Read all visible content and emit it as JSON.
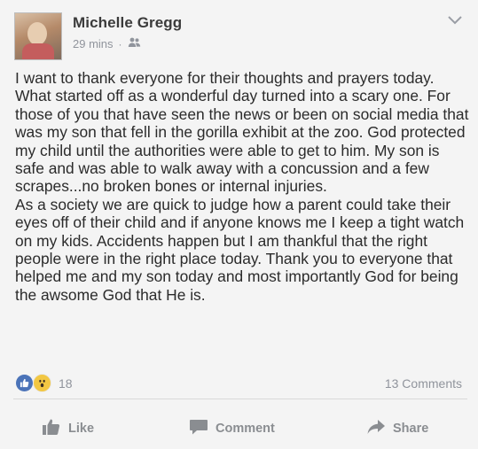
{
  "post": {
    "author": "Michelle Gregg",
    "time": "29 mins",
    "separator": "·",
    "paragraphs": [
      "I want to thank everyone for their thoughts and prayers today. What started off as a wonderful day turned into a scary one. For those of you that have seen the news or been on social media that was my son that fell in the gorilla exhibit at the zoo. God protected my child until the authorities were able to get to him. My son is safe and was able to walk away with a concussion and a few scrapes...no broken bones or internal injuries.",
      "As a society we are quick to judge how a parent could take their eyes off of their child and if anyone knows me I keep a tight watch on my kids. Accidents happen but I am thankful that the right people were in the right place today. Thank you to everyone that helped me and my son today and most importantly God for being the awsome God that He is."
    ],
    "reaction_count": "18",
    "comments_count": "13 Comments",
    "reaction_icons": [
      "like-reaction-icon",
      "wow-reaction-icon"
    ],
    "privacy_icon": "friends-icon",
    "menu_icon": "chevron-down-icon"
  },
  "actions": {
    "like": "Like",
    "comment": "Comment",
    "share": "Share"
  }
}
